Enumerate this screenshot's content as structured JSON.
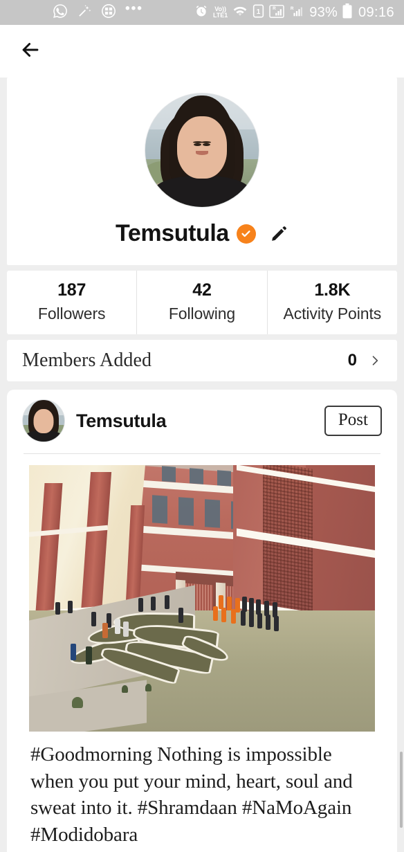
{
  "status_bar": {
    "left_icons": [
      "whatsapp-icon",
      "magic-wand-icon",
      "apps-grid-icon",
      "more-dots-icon"
    ],
    "right_icons": [
      "alarm-icon",
      "volte-icon",
      "wifi-icon",
      "sim1-icon",
      "signal-r1-icon",
      "signal-r2-icon",
      "battery-icon"
    ],
    "volte_top": "Vo))",
    "volte_bottom": "LTE1",
    "sim_label": "1",
    "roaming_label_1": "R",
    "roaming_label_2": "R",
    "battery_percent": "93%",
    "time": "09:16"
  },
  "nav": {
    "back_icon": "back-arrow-icon"
  },
  "profile": {
    "name": "Temsutula",
    "verified_icon": "verified-check-icon",
    "verified_color": "#f7821b",
    "edit_icon": "pencil-edit-icon",
    "avatar_icon": "profile-avatar"
  },
  "stats": [
    {
      "value": "187",
      "label": "Followers"
    },
    {
      "value": "42",
      "label": "Following"
    },
    {
      "value": "1.8K",
      "label": "Activity Points"
    }
  ],
  "members_added": {
    "label": "Members Added",
    "value": "0",
    "chevron_icon": "chevron-right-icon"
  },
  "post": {
    "author": "Temsutula",
    "author_avatar_icon": "post-author-avatar",
    "button_label": "Post",
    "image_icon": "post-photo",
    "caption": "#Goodmorning Nothing is impossible when you put your mind, heart, soul and sweat into it. #Shramdaan #NaMoAgain #Modidobara"
  }
}
